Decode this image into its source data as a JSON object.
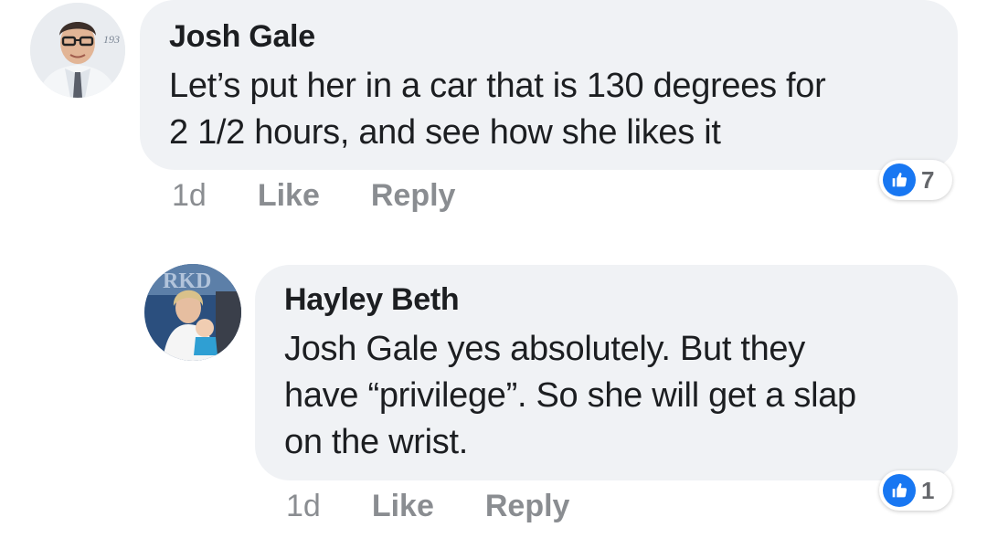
{
  "comments": [
    {
      "author": "Josh Gale",
      "avatar": "profile-photo",
      "lines": [
        "Let’s put her in a car that is 130 degrees for",
        "2 1/2 hours, and see how she likes it"
      ],
      "time": "1d",
      "like_label": "Like",
      "reply_label": "Reply",
      "reaction_icon": "thumbs-up-icon",
      "reaction_count": "7"
    },
    {
      "author": "Hayley Beth",
      "avatar": "profile-photo",
      "lines": [
        "Josh Gale yes absolutely. But they",
        "have “privilege”. So she will get a slap",
        "on the wrist."
      ],
      "time": "1d",
      "like_label": "Like",
      "reply_label": "Reply",
      "reaction_icon": "thumbs-up-icon",
      "reaction_count": "1"
    }
  ],
  "colors": {
    "bubble": "#f0f2f5",
    "text": "#1c1e21",
    "meta": "#8a8d91",
    "like_blue": "#1877f2"
  }
}
